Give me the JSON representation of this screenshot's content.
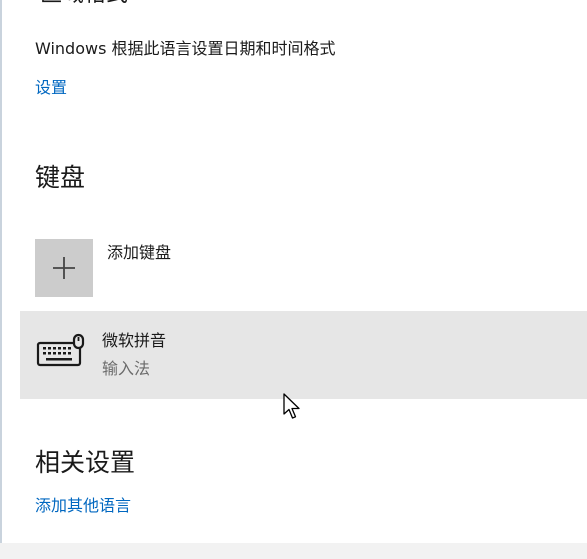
{
  "region": {
    "heading_partial": "区域格式",
    "description": "Windows 根据此语言设置日期和时间格式",
    "settings_link": "设置"
  },
  "keyboard": {
    "title": "键盘",
    "add_keyboard_label": "添加键盘",
    "add_keyboard_icon": "plus-icon",
    "items": [
      {
        "name": "微软拼音",
        "type": "输入法",
        "icon": "keyboard-icon"
      }
    ]
  },
  "related": {
    "title": "相关设置",
    "add_other_language_link": "添加其他语言"
  },
  "colors": {
    "accent_link": "#0067c0",
    "selected_item_bg": "#e6e6e6",
    "plus_tile_bg": "#cccccc",
    "secondary_text": "#6b6b6b"
  }
}
